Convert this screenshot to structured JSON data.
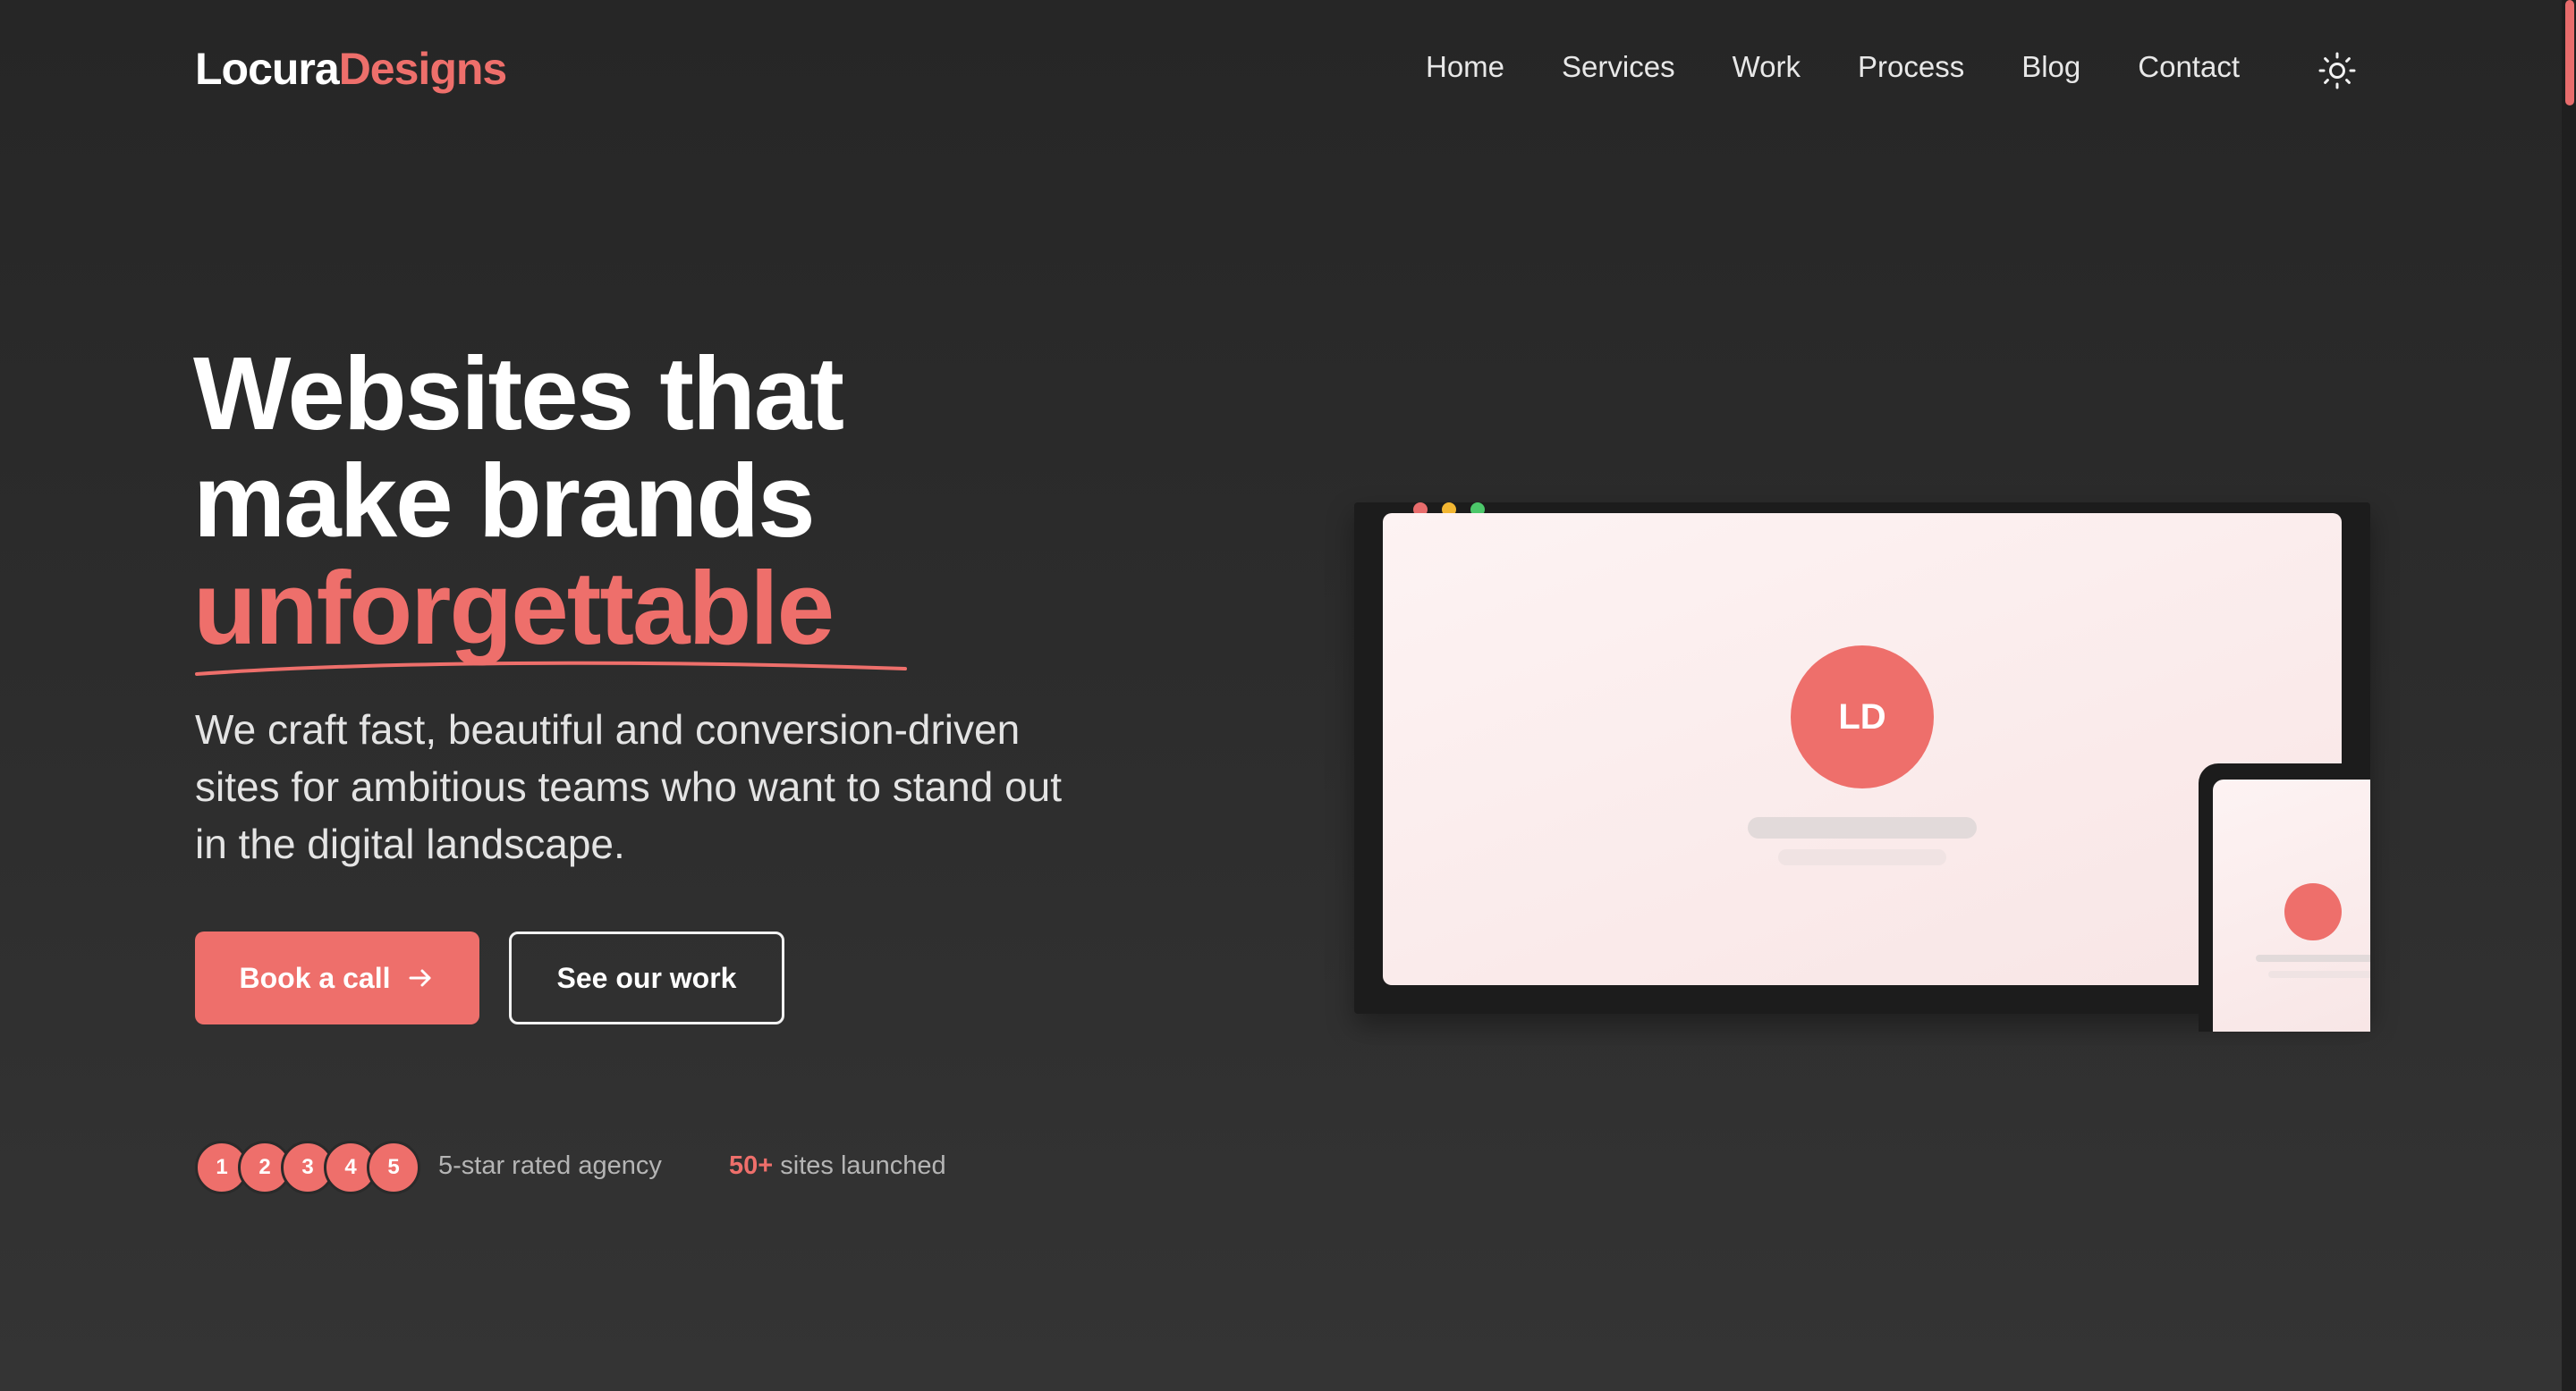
{
  "brand": {
    "name_part1": "Locura",
    "name_part2": "Designs"
  },
  "nav": {
    "items": [
      "Home",
      "Services",
      "Work",
      "Process",
      "Blog",
      "Contact"
    ],
    "theme_toggle_icon": "sun-icon"
  },
  "hero": {
    "title_line1": "Websites that",
    "title_line2": "make brands",
    "title_accent": "unforgettable",
    "subtitle_lines": [
      "We craft fast, beautiful and conversion-driven",
      "sites for ambitious teams who want to stand out",
      "in the digital landscape."
    ],
    "primary_cta": "Book a call",
    "primary_cta_icon": "arrow-right-icon",
    "secondary_cta": "See our work"
  },
  "stats": {
    "rating_badges": [
      "1",
      "2",
      "3",
      "4",
      "5"
    ],
    "rating_label": "5-star rated agency",
    "sites_count": "50+",
    "sites_label": "sites launched"
  },
  "mockup": {
    "avatar_initials": "LD"
  },
  "colors": {
    "accent": "#ee6f6b",
    "background": "#2a2a2a",
    "text": "#ffffff",
    "window_dot_red": "#e86c6c",
    "window_dot_yellow": "#f2b632",
    "window_dot_green": "#4cc76a"
  }
}
